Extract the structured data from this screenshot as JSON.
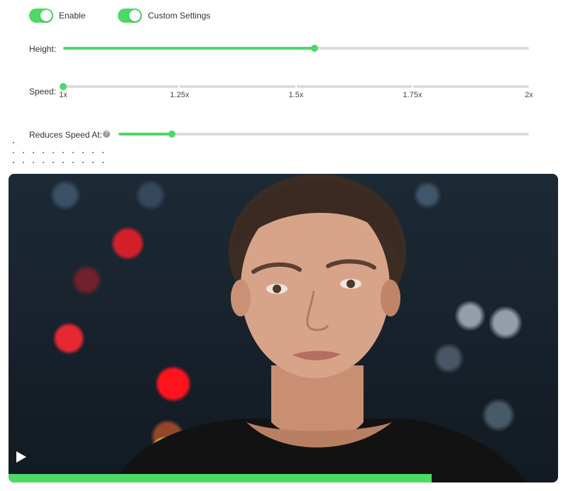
{
  "toggles": {
    "enable": {
      "label": "Enable",
      "on": true
    },
    "custom_settings": {
      "label": "Custom Settings",
      "on": true
    }
  },
  "height": {
    "label": "Height:",
    "value": 0.54
  },
  "speed": {
    "label": "Speed:",
    "value": "1x",
    "ticks": [
      "1x",
      "1.25x",
      "1.5x",
      "1.75x",
      "2x"
    ]
  },
  "reduces_speed": {
    "label": "Reduces Speed At:",
    "value": 0.13,
    "info_icon": "info-icon"
  },
  "video": {
    "progress": 0.77,
    "play_icon": "play-icon"
  },
  "colors": {
    "accent": "#4cd964",
    "track": "#dcdcdc"
  }
}
